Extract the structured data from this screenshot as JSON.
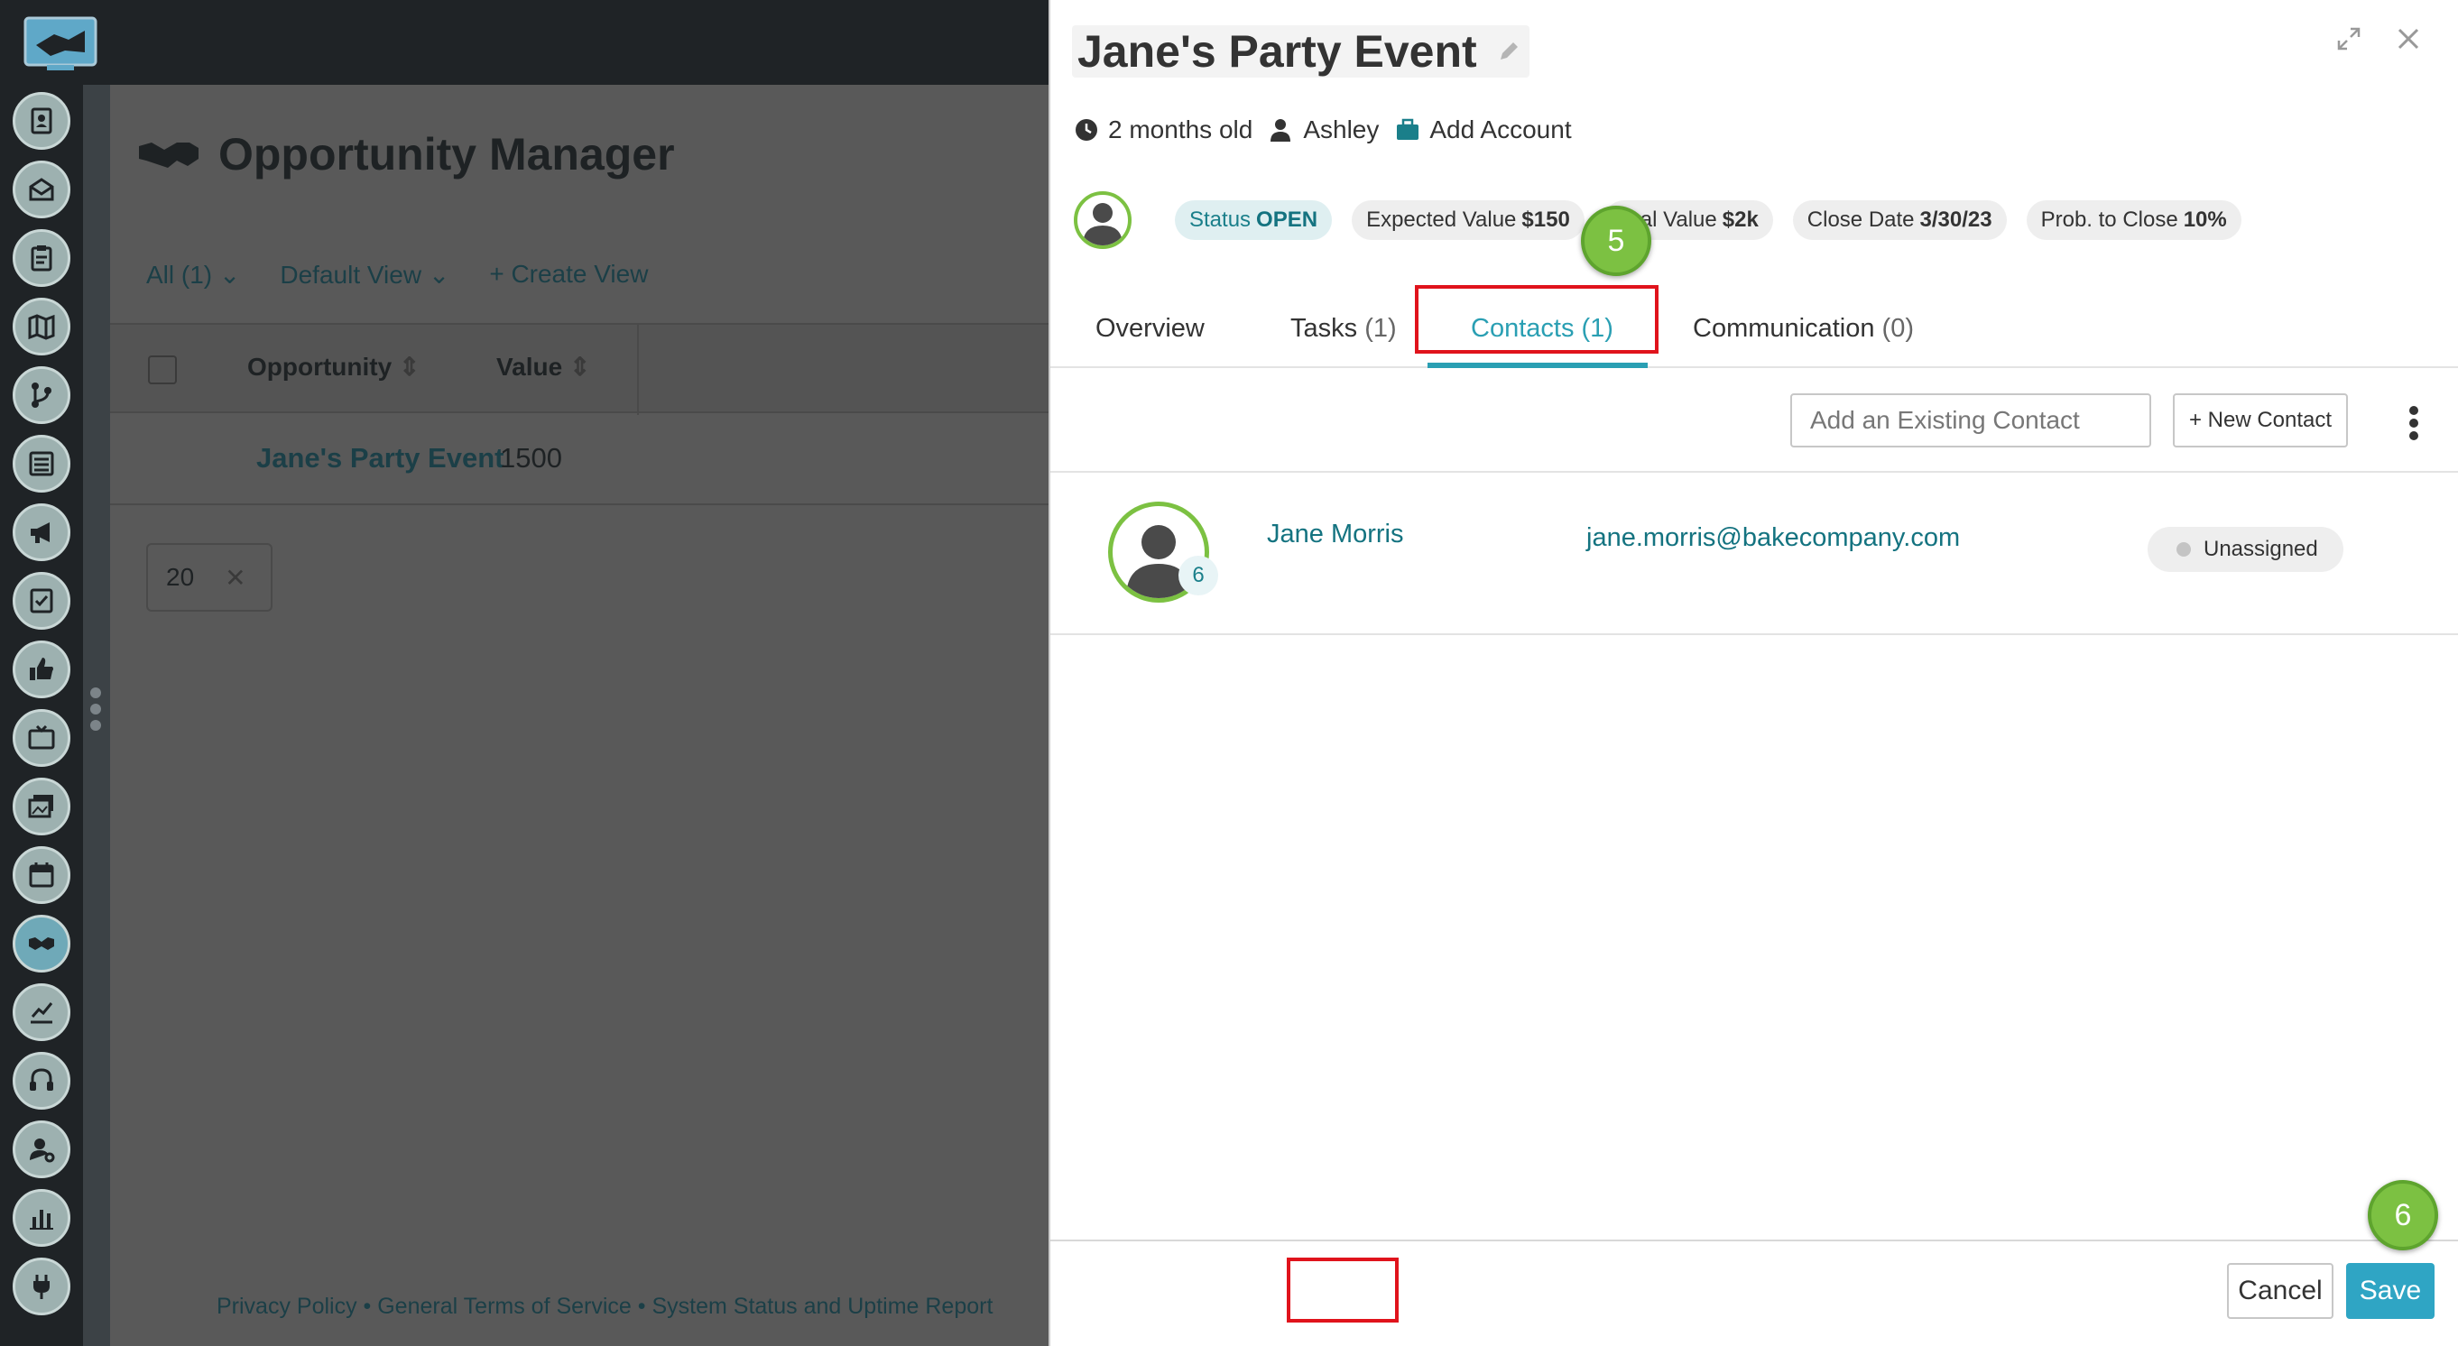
{
  "app": {
    "rail_icons": [
      "contact-book-icon",
      "inbox-icon",
      "clipboard-icon",
      "map-icon",
      "branch-icon",
      "list-icon",
      "megaphone-icon",
      "survey-icon",
      "thumbs-up-icon",
      "tv-icon",
      "images-icon",
      "calendar-icon",
      "handshake-icon",
      "chart-icon",
      "headset-icon",
      "user-settings-icon",
      "bar-chart-icon",
      "plug-icon"
    ]
  },
  "main": {
    "title": "Opportunity Manager",
    "views": {
      "all": "All  (1)",
      "default_view": "Default View",
      "create_view": "+ Create View"
    },
    "columns": {
      "opportunity": "Opportunity",
      "value": "Value"
    },
    "row": {
      "name": "Jane's Party Event",
      "value": "1500"
    },
    "pager": {
      "size": "20"
    },
    "footer": "Privacy Policy • General Terms of Service • System Status and Uptime Report"
  },
  "panel": {
    "title": "Jane's Party Event",
    "age": "2 months old",
    "owner": "Ashley",
    "add_account": "Add Account",
    "chips": {
      "status_label": "Status",
      "status_value": "OPEN",
      "expected_label": "Expected Value",
      "expected_value": "$150",
      "actual_label": "al Value",
      "actual_value": "$2k",
      "close_label": "Close Date",
      "close_value": "3/30/23",
      "prob_label": "Prob. to Close",
      "prob_value": "10%"
    },
    "tabs": {
      "overview": "Overview",
      "tasks": "Tasks",
      "tasks_count": "(1)",
      "contacts": "Contacts",
      "contacts_count": "(1)",
      "communication": "Communication",
      "communication_count": "(0)"
    },
    "contacts": {
      "add_placeholder": "Add an Existing Contact",
      "new_button": "+ New Contact",
      "rows": [
        {
          "badge": "6",
          "name": "Jane Morris",
          "email": "jane.morris@bakecompany.com",
          "status": "Unassigned"
        }
      ]
    },
    "footer": {
      "cancel": "Cancel",
      "save": "Save"
    }
  },
  "annotations": {
    "step_5": "5",
    "step_6": "6",
    "highlight_color": "#e0131c",
    "step_color": "#7cc142"
  },
  "colors": {
    "accent": "#2a9fb3",
    "link": "#147380",
    "save": "#2fa5c4",
    "avatar_ring": "#7cc142"
  }
}
